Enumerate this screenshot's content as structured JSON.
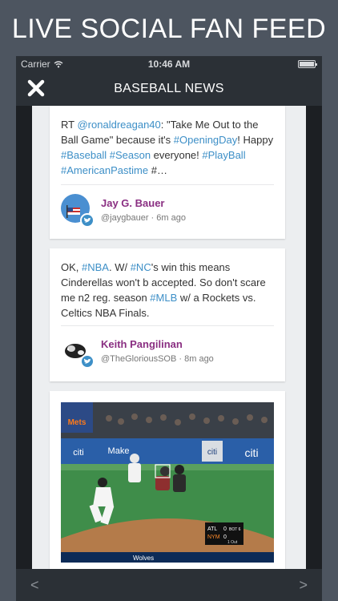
{
  "banner": {
    "title": "LIVE SOCIAL FAN FEED"
  },
  "status_bar": {
    "carrier": "Carrier",
    "time": "10:46 AM"
  },
  "nav": {
    "title": "BASEBALL NEWS",
    "close_icon": "close-icon"
  },
  "posts": [
    {
      "segments": [
        {
          "text": "RT ",
          "link": false
        },
        {
          "text": "@ronaldreagan40",
          "link": true
        },
        {
          "text": ": \"Take Me Out to the Ball Game\" because it's ",
          "link": false
        },
        {
          "text": "#OpeningDay",
          "link": true
        },
        {
          "text": "! Happy ",
          "link": false
        },
        {
          "text": "#Baseball",
          "link": true
        },
        {
          "text": " ",
          "link": false
        },
        {
          "text": "#Season",
          "link": true
        },
        {
          "text": " everyone! ",
          "link": false
        },
        {
          "text": "#PlayBall",
          "link": true
        },
        {
          "text": " ",
          "link": false
        },
        {
          "text": "#AmericanPastime",
          "link": true
        },
        {
          "text": " #…",
          "link": false
        }
      ],
      "author": "Jay G. Bauer",
      "handle": "@jaygbauer",
      "time": "6m ago",
      "source_icon": "twitter-icon"
    },
    {
      "segments": [
        {
          "text": "OK, ",
          "link": false
        },
        {
          "text": "#NBA",
          "link": true
        },
        {
          "text": ". W/ ",
          "link": false
        },
        {
          "text": "#NC",
          "link": true
        },
        {
          "text": "'s win this means Cinderellas won't b accepted. So don't scare me n2 reg. season ",
          "link": false
        },
        {
          "text": "#MLB",
          "link": true
        },
        {
          "text": " w/ a Rockets vs. Celtics NBA Finals.",
          "link": false
        }
      ],
      "author": "Keith Pangilinan",
      "handle": "@TheGloriousSOB",
      "time": "8m ago",
      "source_icon": "twitter-icon"
    }
  ],
  "photo_post": {
    "scoreboard": {
      "away": "ATL",
      "away_score": "0",
      "home": "NYM",
      "home_score": "0",
      "inning": "BOT 6",
      "outs": "1 Out"
    },
    "signage": [
      "Mets",
      "citi",
      "Make",
      "citi",
      "citi"
    ],
    "ticker": "Wolves"
  },
  "bottom_nav": {
    "prev": "<",
    "next": ">"
  },
  "colors": {
    "link": "#3d8fc7",
    "author": "#8a2f82",
    "bar": "#2b3036"
  }
}
